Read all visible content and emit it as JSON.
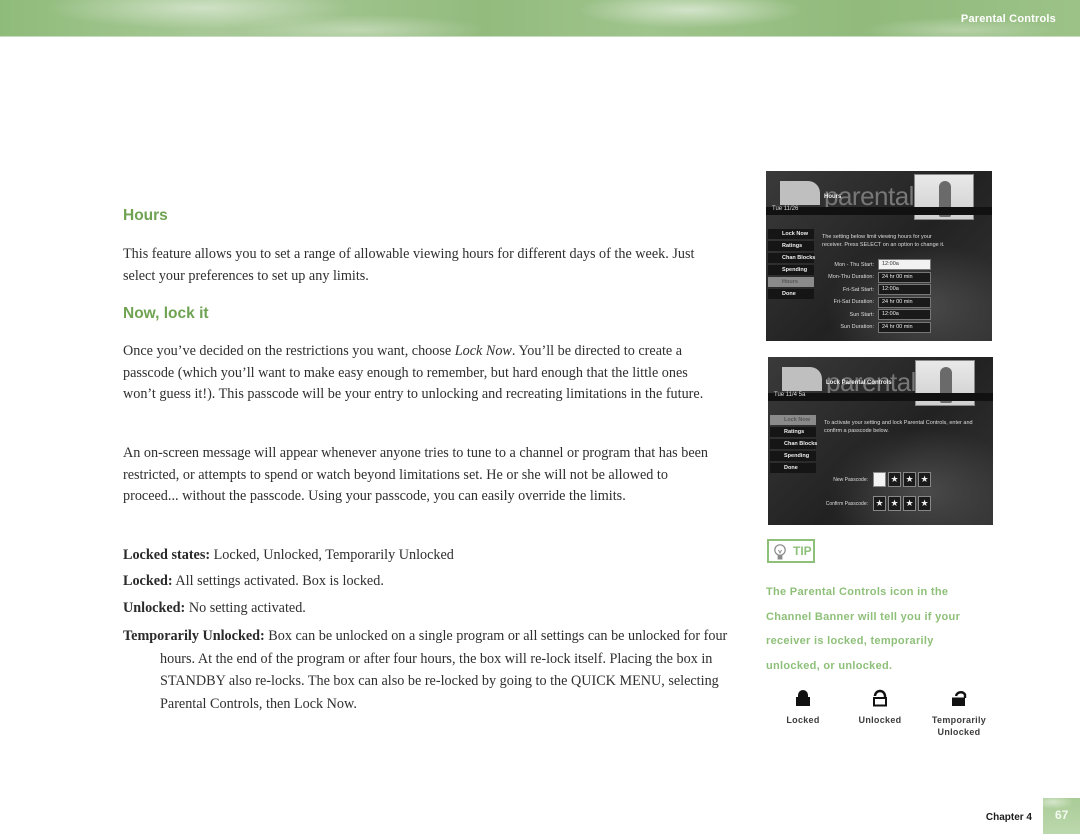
{
  "header": {
    "section_title": "Parental Controls"
  },
  "sections": {
    "hours": {
      "heading": "Hours",
      "body": "This feature allows you to set a range of allowable viewing hours for different days of the week. Just select your preferences to set up any limits."
    },
    "lock": {
      "heading": "Now, lock it",
      "body_before": "Once you’ve decided on the restrictions you want, choose ",
      "body_italic": "Lock Now",
      "body_after": ". You’ll be directed to create a passcode (which you’ll want to make easy enough to remember, but hard enough that the little ones won’t guess it!). This passcode will be your entry to unlocking and recreating limitations in the future.",
      "body2": "An on-screen message will appear whenever anyone tries to tune to a channel or program that has been restricted, or attempts to spend or watch beyond limitations set. He or she will not be allowed to proceed... without the passcode. Using your passcode, you can easily override the limits."
    },
    "definitions": [
      {
        "term": "Locked states:",
        "text": " Locked, Unlocked, Temporarily Unlocked"
      },
      {
        "term": "Locked:",
        "text": " All settings activated. Box is locked."
      },
      {
        "term": "Unlocked:",
        "text": " No setting activated."
      },
      {
        "term": "Temporarily Unlocked:",
        "text": " Box can be unlocked on a single program or all settings can be unlocked for four hours. At the end of the program or after four hours, the box will re-lock itself. Placing the box in STANDBY also re-locks. The box can also be re-locked by going to the QUICK MENU, selecting Parental  Controls, then Lock Now."
      }
    ]
  },
  "screens": {
    "hours_screen": {
      "brand": "parental",
      "sublabel": "Hours",
      "date": "Tue 11/26",
      "menu": [
        "Lock Now",
        "Ratings",
        "Chan Blocks",
        "Spending",
        "Hours",
        "Done"
      ],
      "selected_menu": "Hours",
      "description": "The setting below limit viewing hours for your receiver. Press SELECT on an option to change it.",
      "rows": [
        {
          "label": "Mon - Thu Start:",
          "value": "12:00a"
        },
        {
          "label": "Mon-Thu Duration:",
          "value": "24 hr 00 min"
        },
        {
          "label": "Fri-Sat Start:",
          "value": "12:00a"
        },
        {
          "label": "Fri-Sat Duration:",
          "value": "24 hr 00 min"
        },
        {
          "label": "Sun Start:",
          "value": "12:00a"
        },
        {
          "label": "Sun Duration:",
          "value": "24 hr 00 min"
        }
      ]
    },
    "lock_screen": {
      "brand": "parental",
      "sublabel": "Lock Parental Controls",
      "date": "Tue 11/4 5a",
      "menu": [
        "Lock Now",
        "Ratings",
        "Chan Blocks",
        "Spending",
        "Done"
      ],
      "selected_menu": "Lock Now",
      "description": "To activate your setting and lock Parental Controls, enter and confirm a passcode below.",
      "new_passcode_label": "New Passcode:",
      "confirm_passcode_label": "Confirm Passcode:",
      "mask_char": "★"
    }
  },
  "tip": {
    "label": "TIP",
    "text": "The Parental Controls icon in the Channel Banner will tell you if your receiver is locked, temporarily unlocked, or unlocked.",
    "icons": [
      {
        "icon": "lock-closed-icon",
        "label": "Locked"
      },
      {
        "icon": "lock-open-icon",
        "label": "Unlocked"
      },
      {
        "icon": "lock-temp-icon",
        "label": "Temporarily Unlocked"
      }
    ]
  },
  "footer": {
    "chapter": "Chapter 4",
    "page": "67"
  },
  "colors": {
    "accent_green": "#6fa351",
    "tip_green": "#8fc07a"
  }
}
